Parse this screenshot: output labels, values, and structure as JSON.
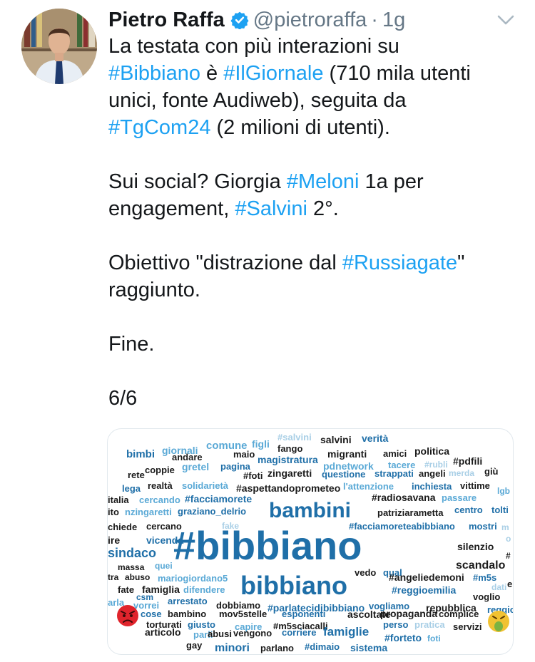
{
  "tweet": {
    "author_name": "Pietro Raffa",
    "handle": "@pietroraffa",
    "separator": "·",
    "time": "1g",
    "lines": {
      "l1": "La testata con più interazioni su",
      "l2_tag1": "#Bibbiano",
      "l2_mid": " è ",
      "l2_tag2": "#IlGiornale",
      "l2_end": " (710 mila utenti",
      "l3": "unici, fonte Audiweb), seguita da",
      "l4_tag": "#TgCom24",
      "l4_end": " (2 milioni di utenti).",
      "l5_start": "Sui social? Giorgia ",
      "l5_tag": "#Meloni",
      "l5_end": " 1a per",
      "l6_start": "engagement, ",
      "l6_tag": "#Salvini",
      "l6_end": " 2°.",
      "l7_start": "Obiettivo \"distrazione dal ",
      "l7_tag": "#Russiagate",
      "l7_end": "\"",
      "l8": "raggiunto.",
      "l9": "Fine.",
      "l10": "6/6"
    }
  },
  "icons": {
    "verified": "verified-badge-icon",
    "caret": "chevron-down-icon",
    "angry": "angry-face-icon",
    "sick": "vomiting-face-icon"
  },
  "colors": {
    "link": "#1da1f2",
    "text": "#14171a",
    "muted": "#657786",
    "cloud_dark": "#1a1a1a",
    "cloud_blue": "#1f6fa8",
    "cloud_light": "#5aa9d6",
    "cloud_pale": "#a9cfe6"
  },
  "wordcloud": {
    "words": [
      {
        "t": "bimbi",
        "c": "cloud_blue"
      },
      {
        "t": "giornali",
        "c": "cloud_light"
      },
      {
        "t": "comune",
        "c": "cloud_light"
      },
      {
        "t": "figli",
        "c": "cloud_light"
      },
      {
        "t": "#salvini",
        "c": "cloud_pale"
      },
      {
        "t": "salvini",
        "c": "cloud_dark"
      },
      {
        "t": "verità",
        "c": "cloud_blue"
      },
      {
        "t": "andare",
        "c": "cloud_dark"
      },
      {
        "t": "maio",
        "c": "cloud_dark"
      },
      {
        "t": "fango",
        "c": "cloud_dark"
      },
      {
        "t": "magistratura",
        "c": "cloud_blue"
      },
      {
        "t": "migranti",
        "c": "cloud_dark"
      },
      {
        "t": "amici",
        "c": "cloud_dark"
      },
      {
        "t": "politica",
        "c": "cloud_dark"
      },
      {
        "t": "coppie",
        "c": "cloud_dark"
      },
      {
        "t": "gretel",
        "c": "cloud_light"
      },
      {
        "t": "pagina",
        "c": "cloud_blue"
      },
      {
        "t": "pdnetwork",
        "c": "cloud_light"
      },
      {
        "t": "tacere",
        "c": "cloud_light"
      },
      {
        "t": "#rubli",
        "c": "cloud_pale"
      },
      {
        "t": "#pdfili",
        "c": "cloud_dark"
      },
      {
        "t": "rete",
        "c": "cloud_dark"
      },
      {
        "t": "#foti",
        "c": "cloud_dark"
      },
      {
        "t": "zingaretti",
        "c": "cloud_dark"
      },
      {
        "t": "questione",
        "c": "cloud_blue"
      },
      {
        "t": "strappati",
        "c": "cloud_blue"
      },
      {
        "t": "angeli",
        "c": "cloud_dark"
      },
      {
        "t": "merda",
        "c": "cloud_pale"
      },
      {
        "t": "giù",
        "c": "cloud_dark"
      },
      {
        "t": "lega",
        "c": "cloud_blue"
      },
      {
        "t": "realtà",
        "c": "cloud_dark"
      },
      {
        "t": "solidarietà",
        "c": "cloud_light"
      },
      {
        "t": "#aspettandoprometeo",
        "c": "cloud_dark"
      },
      {
        "t": "l'attenzione",
        "c": "cloud_light"
      },
      {
        "t": "inchiesta",
        "c": "cloud_blue"
      },
      {
        "t": "vittime",
        "c": "cloud_dark"
      },
      {
        "t": "lgb",
        "c": "cloud_light"
      },
      {
        "t": "italia",
        "c": "cloud_dark"
      },
      {
        "t": "cercando",
        "c": "cloud_light"
      },
      {
        "t": "#facciamorete",
        "c": "cloud_blue"
      },
      {
        "t": "#radiosavana",
        "c": "cloud_dark"
      },
      {
        "t": "passare",
        "c": "cloud_light"
      },
      {
        "t": "ito",
        "c": "cloud_dark"
      },
      {
        "t": "nzingaretti",
        "c": "cloud_light"
      },
      {
        "t": "graziano_delrio",
        "c": "cloud_blue"
      },
      {
        "t": "bambini",
        "c": "cloud_blue"
      },
      {
        "t": "patriziarametta",
        "c": "cloud_dark"
      },
      {
        "t": "centro",
        "c": "cloud_blue"
      },
      {
        "t": "tolti",
        "c": "cloud_blue"
      },
      {
        "t": "chiede",
        "c": "cloud_dark"
      },
      {
        "t": "cercano",
        "c": "cloud_dark"
      },
      {
        "t": "fake",
        "c": "cloud_pale"
      },
      {
        "t": "#facciamoreteabibbiano",
        "c": "cloud_blue"
      },
      {
        "t": "mostri",
        "c": "cloud_blue"
      },
      {
        "t": "m",
        "c": "cloud_pale"
      },
      {
        "t": "ire",
        "c": "cloud_dark"
      },
      {
        "t": "vicenda",
        "c": "cloud_blue"
      },
      {
        "t": "#bibbiano",
        "c": "cloud_blue"
      },
      {
        "t": "silenzio",
        "c": "cloud_dark"
      },
      {
        "t": "o",
        "c": "cloud_pale"
      },
      {
        "t": "sindaco",
        "c": "cloud_blue"
      },
      {
        "t": "massa",
        "c": "cloud_dark"
      },
      {
        "t": "quei",
        "c": "cloud_light"
      },
      {
        "t": "scandalo",
        "c": "cloud_dark"
      },
      {
        "t": "#",
        "c": "cloud_dark"
      },
      {
        "t": "tra",
        "c": "cloud_dark"
      },
      {
        "t": "abuso",
        "c": "cloud_dark"
      },
      {
        "t": "mariogiordano5",
        "c": "cloud_light"
      },
      {
        "t": "vedo",
        "c": "cloud_dark"
      },
      {
        "t": "qual",
        "c": "cloud_blue"
      },
      {
        "t": "#angeliedemoni",
        "c": "cloud_dark"
      },
      {
        "t": "#m5s",
        "c": "cloud_blue"
      },
      {
        "t": "bibbiano",
        "c": "cloud_blue"
      },
      {
        "t": "fate",
        "c": "cloud_dark"
      },
      {
        "t": "famiglia",
        "c": "cloud_dark"
      },
      {
        "t": "difendere",
        "c": "cloud_light"
      },
      {
        "t": "dati",
        "c": "cloud_pale"
      },
      {
        "t": "e",
        "c": "cloud_dark"
      },
      {
        "t": "arla",
        "c": "cloud_light"
      },
      {
        "t": "csm",
        "c": "cloud_blue"
      },
      {
        "t": "vorrei",
        "c": "cloud_light"
      },
      {
        "t": "arrestato",
        "c": "cloud_blue"
      },
      {
        "t": "#reggioemilia",
        "c": "cloud_blue"
      },
      {
        "t": "voglio",
        "c": "cloud_dark"
      },
      {
        "t": "dobbiamo",
        "c": "cloud_dark"
      },
      {
        "t": "#parlatecidibibbiano",
        "c": "cloud_blue"
      },
      {
        "t": "vogliamo",
        "c": "cloud_blue"
      },
      {
        "t": "repubblica",
        "c": "cloud_dark"
      },
      {
        "t": "reggio",
        "c": "cloud_blue"
      },
      {
        "t": "cose",
        "c": "cloud_blue"
      },
      {
        "t": "bambino",
        "c": "cloud_dark"
      },
      {
        "t": "mov5stelle",
        "c": "cloud_dark"
      },
      {
        "t": "esponenti",
        "c": "cloud_blue"
      },
      {
        "t": "ascoltate",
        "c": "cloud_dark"
      },
      {
        "t": "propaganda",
        "c": "cloud_dark"
      },
      {
        "t": "complice",
        "c": "cloud_dark"
      },
      {
        "t": "torturati",
        "c": "cloud_dark"
      },
      {
        "t": "giusto",
        "c": "cloud_blue"
      },
      {
        "t": "capire",
        "c": "cloud_light"
      },
      {
        "t": "#m5sciacalli",
        "c": "cloud_dark"
      },
      {
        "t": "perso",
        "c": "cloud_blue"
      },
      {
        "t": "pratica",
        "c": "cloud_pale"
      },
      {
        "t": "servizi",
        "c": "cloud_dark"
      },
      {
        "t": "parli",
        "c": "cloud_light"
      },
      {
        "t": "articolo",
        "c": "cloud_dark"
      },
      {
        "t": "abusi",
        "c": "cloud_dark"
      },
      {
        "t": "vengono",
        "c": "cloud_dark"
      },
      {
        "t": "corriere",
        "c": "cloud_blue"
      },
      {
        "t": "famiglie",
        "c": "cloud_blue"
      },
      {
        "t": "#forteto",
        "c": "cloud_blue"
      },
      {
        "t": "foti",
        "c": "cloud_light"
      },
      {
        "t": "gay",
        "c": "cloud_dark"
      },
      {
        "t": "minori",
        "c": "cloud_blue"
      },
      {
        "t": "parlano",
        "c": "cloud_dark"
      },
      {
        "t": "#dimaio",
        "c": "cloud_blue"
      },
      {
        "t": "sistema",
        "c": "cloud_blue"
      }
    ]
  }
}
